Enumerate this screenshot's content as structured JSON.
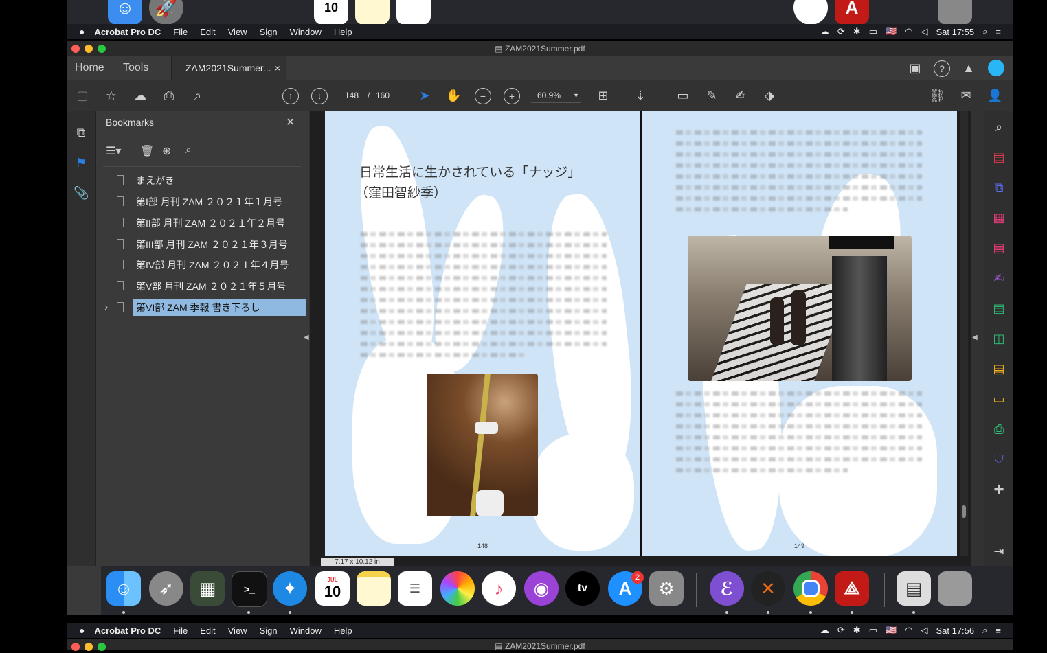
{
  "menubar": {
    "apple": "",
    "app_name": "Acrobat Pro DC",
    "items": [
      "File",
      "Edit",
      "View",
      "Sign",
      "Window",
      "Help"
    ],
    "lang_flag": "🇺🇸",
    "clock_top": "Sat 17:55",
    "clock_bottom": "Sat 17:56"
  },
  "window": {
    "title": "ZAM2021Summer.pdf",
    "nav": {
      "home": "Home",
      "tools": "Tools",
      "tab_label": "ZAM2021Summer...",
      "tab_close": "×"
    },
    "page_current": "148",
    "page_sep": "/",
    "page_total": "160",
    "zoom": "60.9%",
    "page_size": "7.17 x 10.12 in"
  },
  "bookmarks": {
    "title": "Bookmarks",
    "close": "✕",
    "items": [
      {
        "label": "まえがき"
      },
      {
        "label": "第I部 月刊 ZAM ２０２１年１月号"
      },
      {
        "label": "第II部 月刊 ZAM ２０２１年２月号"
      },
      {
        "label": "第III部 月刊 ZAM ２０２１年３月号"
      },
      {
        "label": "第IV部 月刊 ZAM ２０２１年４月号"
      },
      {
        "label": "第V部 月刊 ZAM ２０２１年５月号"
      },
      {
        "label": "第VI部 ZAM 季報 書き下ろし"
      }
    ],
    "expand_glyph": "›"
  },
  "document": {
    "left_page": {
      "heading_1": "日常生活に生かされている「ナッジ」",
      "heading_2": "（窪田智紗季）",
      "page_no": "148"
    },
    "right_page": {
      "page_no": "149"
    }
  },
  "dock": {
    "calendar_month": "JUL",
    "calendar_day": "10",
    "appstore_badge": "2",
    "tv_label": "tv"
  },
  "colors": {
    "highlight": "#8fb9e0",
    "page_bg": "#cfe4f7",
    "accent_blue": "#2a7ee0",
    "tool_pink": "#e23b78"
  }
}
